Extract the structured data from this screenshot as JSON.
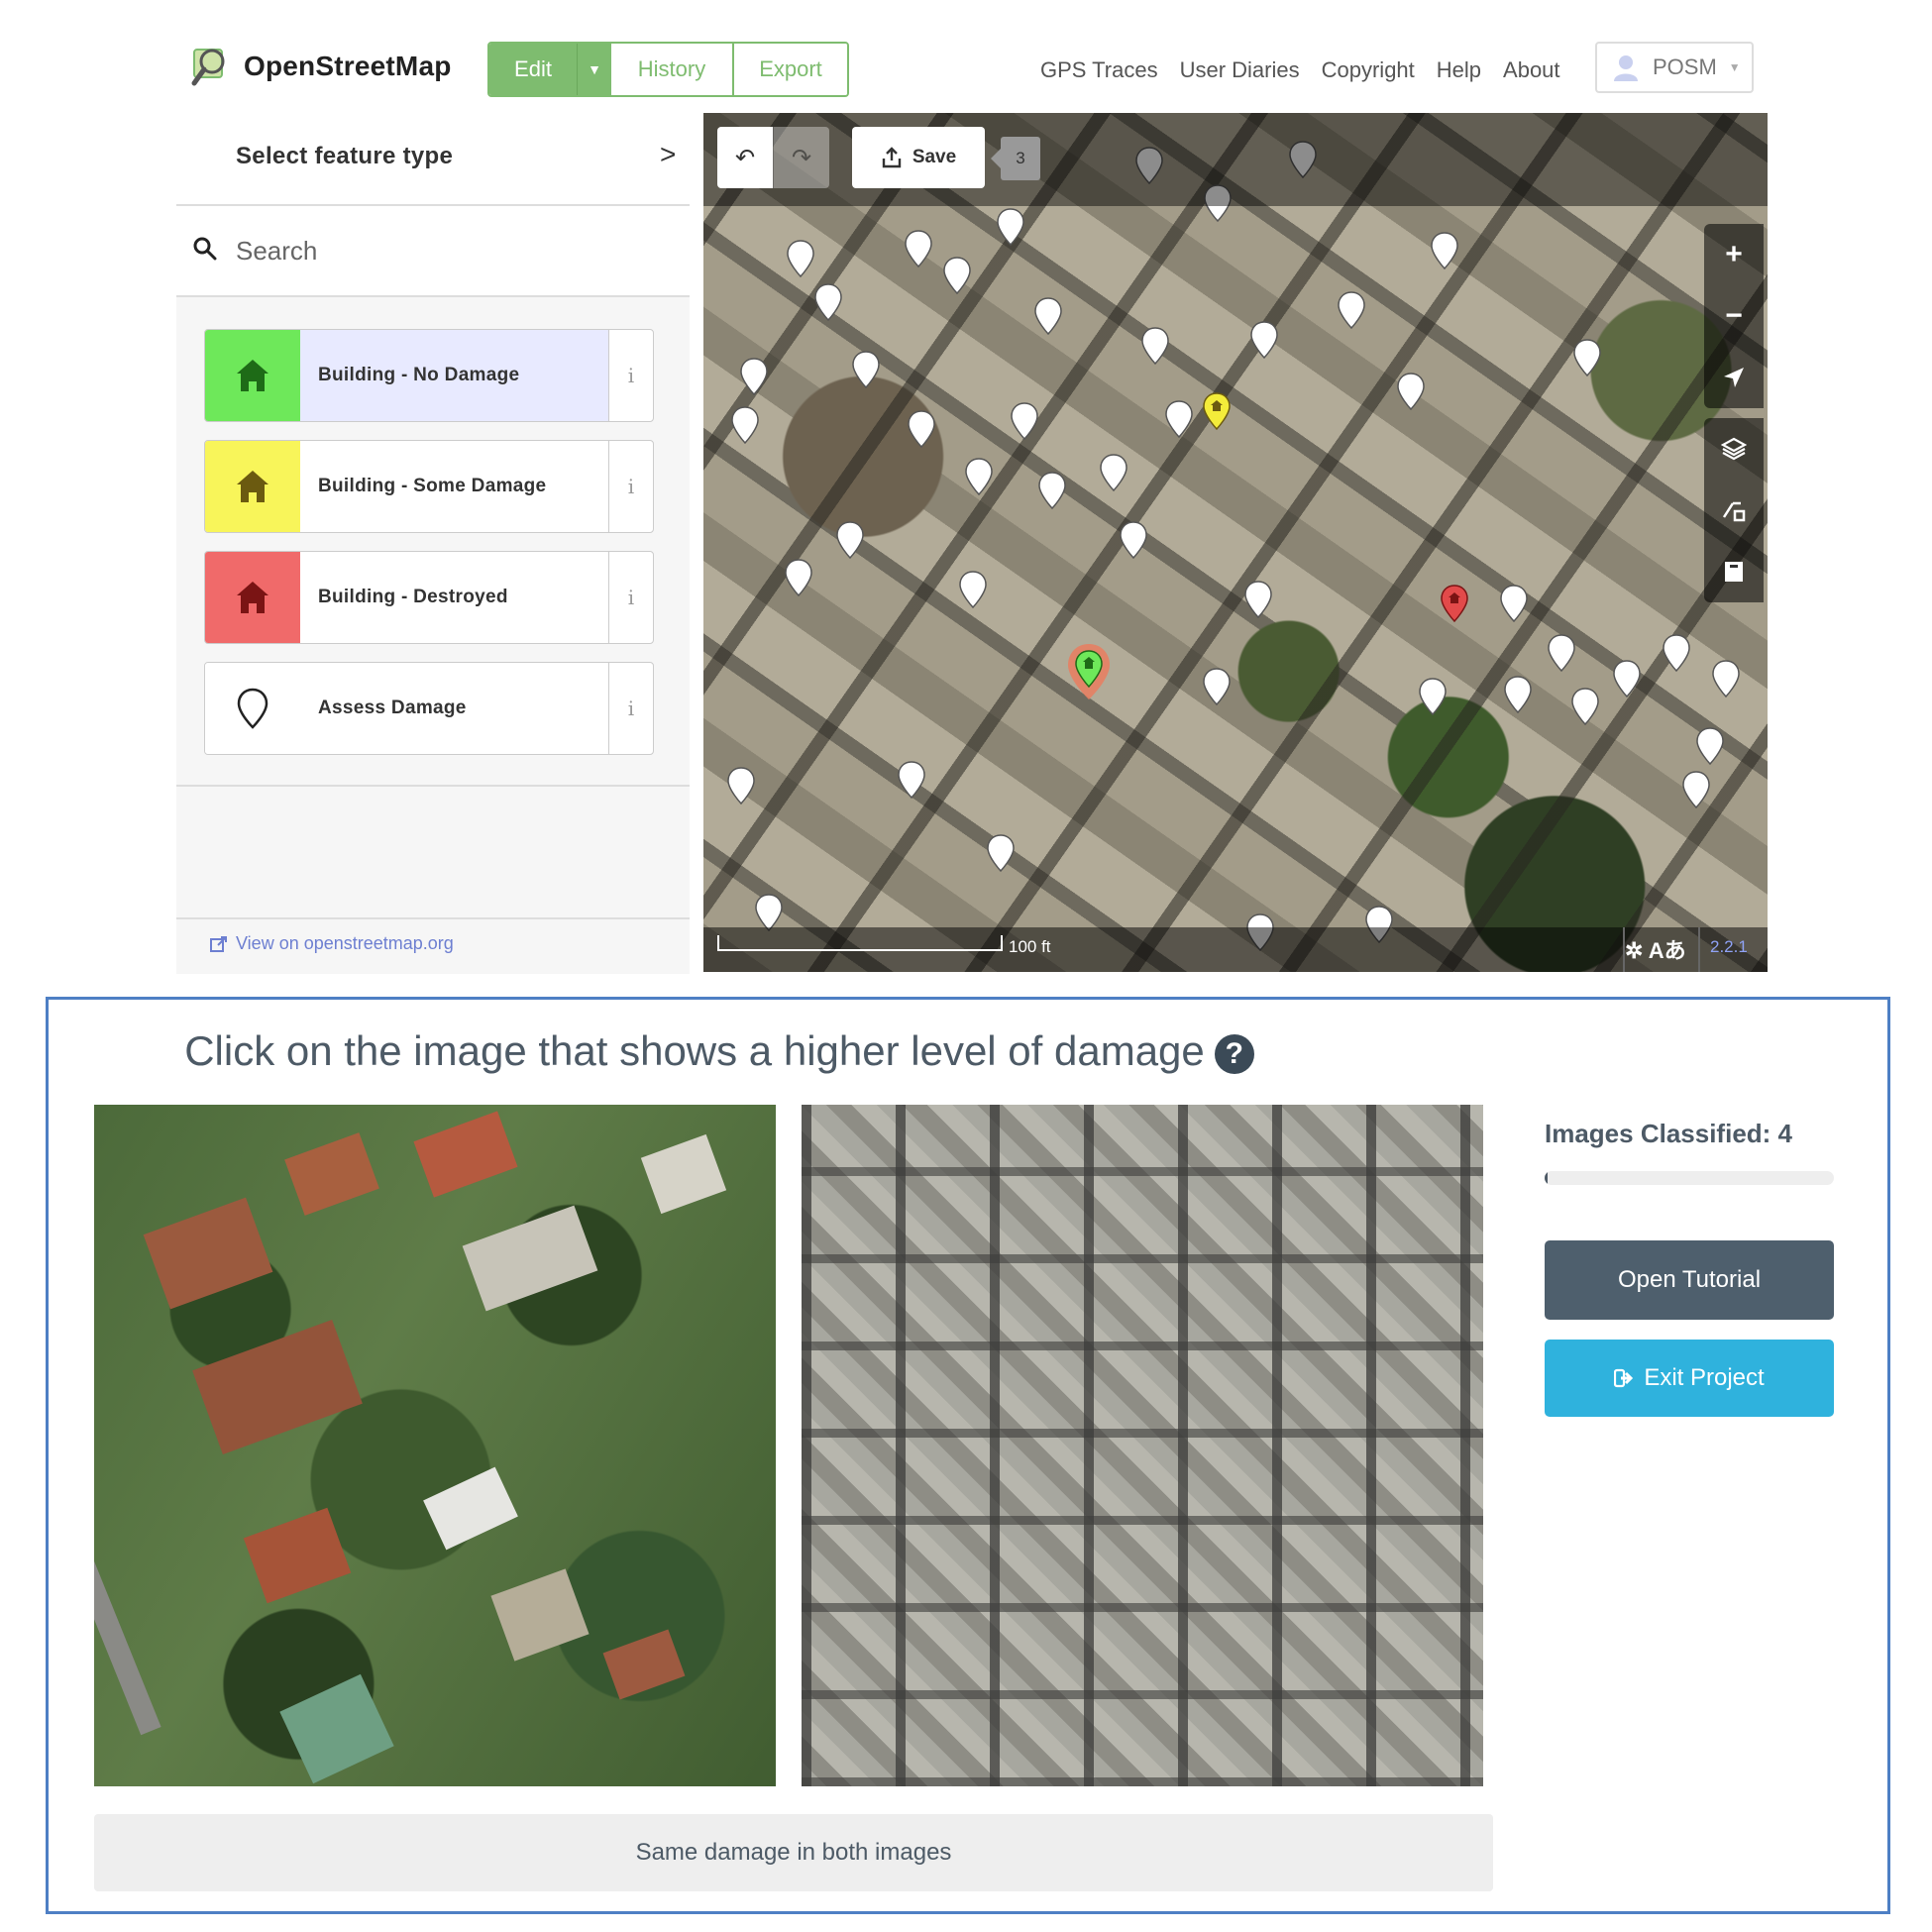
{
  "osm": {
    "brand": "OpenStreetMap",
    "nav_buttons": {
      "edit": "Edit",
      "history": "History",
      "export": "Export"
    },
    "top_links": [
      "GPS Traces",
      "User Diaries",
      "Copyright",
      "Help",
      "About"
    ],
    "user": "POSM",
    "sidebar": {
      "title": "Select feature type",
      "search_placeholder": "Search",
      "presets": [
        {
          "label": "Building - No Damage",
          "icon": "house-icon",
          "color": "#6ee85a",
          "icon_color": "#1e6b17",
          "selected": true
        },
        {
          "label": "Building - Some Damage",
          "icon": "house-icon",
          "color": "#f8f55a",
          "icon_color": "#6b5a10",
          "selected": false
        },
        {
          "label": "Building - Destroyed",
          "icon": "house-icon",
          "color": "#f06a6a",
          "icon_color": "#7a1414",
          "selected": false
        },
        {
          "label": "Assess Damage",
          "icon": "map-pin-outline-icon",
          "color": "#ffffff",
          "icon_color": "#222222",
          "selected": false
        }
      ],
      "info_glyph": "i",
      "footer_link": "View on openstreetmap.org"
    },
    "map": {
      "save_label": "Save",
      "edit_count": "3",
      "scale_label": "100 ft",
      "version": "2.2.1",
      "issues_glyph": "Aあ"
    }
  },
  "task": {
    "title": "Click on the image that shows a higher level of damage",
    "help_glyph": "?",
    "images_classified_label": "Images Classified: 4",
    "progress_fraction": 0.01,
    "open_tutorial": "Open Tutorial",
    "exit_project": "Exit Project",
    "same_damage": "Same damage in both images",
    "colors": {
      "accent": "#2fb2dd",
      "dark": "#4e5f6d",
      "text": "#4d5a66",
      "frame": "#4e7fc4"
    }
  }
}
